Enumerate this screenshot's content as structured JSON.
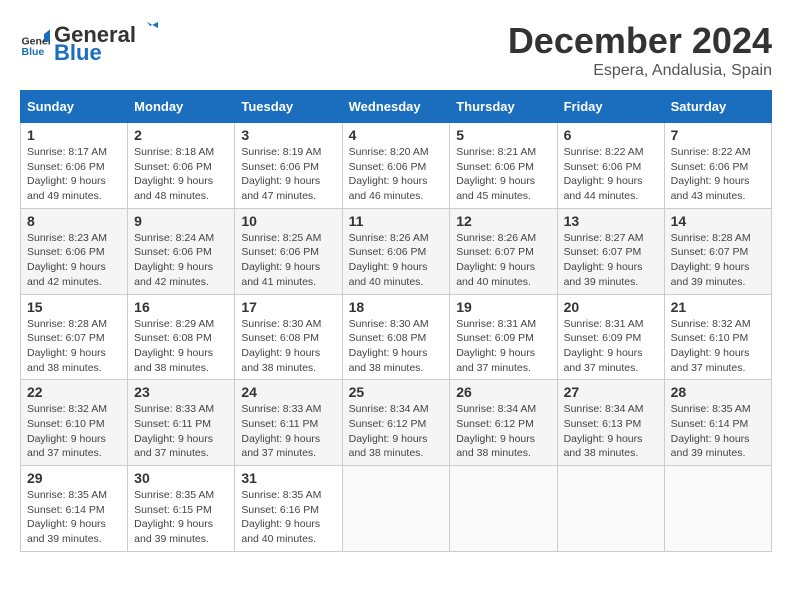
{
  "header": {
    "logo_general": "General",
    "logo_blue": "Blue",
    "main_title": "December 2024",
    "subtitle": "Espera, Andalusia, Spain"
  },
  "calendar": {
    "weekdays": [
      "Sunday",
      "Monday",
      "Tuesday",
      "Wednesday",
      "Thursday",
      "Friday",
      "Saturday"
    ],
    "weeks": [
      [
        {
          "day": "1",
          "sunrise": "8:17 AM",
          "sunset": "6:06 PM",
          "daylight": "9 hours and 49 minutes."
        },
        {
          "day": "2",
          "sunrise": "8:18 AM",
          "sunset": "6:06 PM",
          "daylight": "9 hours and 48 minutes."
        },
        {
          "day": "3",
          "sunrise": "8:19 AM",
          "sunset": "6:06 PM",
          "daylight": "9 hours and 47 minutes."
        },
        {
          "day": "4",
          "sunrise": "8:20 AM",
          "sunset": "6:06 PM",
          "daylight": "9 hours and 46 minutes."
        },
        {
          "day": "5",
          "sunrise": "8:21 AM",
          "sunset": "6:06 PM",
          "daylight": "9 hours and 45 minutes."
        },
        {
          "day": "6",
          "sunrise": "8:22 AM",
          "sunset": "6:06 PM",
          "daylight": "9 hours and 44 minutes."
        },
        {
          "day": "7",
          "sunrise": "8:22 AM",
          "sunset": "6:06 PM",
          "daylight": "9 hours and 43 minutes."
        }
      ],
      [
        {
          "day": "8",
          "sunrise": "8:23 AM",
          "sunset": "6:06 PM",
          "daylight": "9 hours and 42 minutes."
        },
        {
          "day": "9",
          "sunrise": "8:24 AM",
          "sunset": "6:06 PM",
          "daylight": "9 hours and 42 minutes."
        },
        {
          "day": "10",
          "sunrise": "8:25 AM",
          "sunset": "6:06 PM",
          "daylight": "9 hours and 41 minutes."
        },
        {
          "day": "11",
          "sunrise": "8:26 AM",
          "sunset": "6:06 PM",
          "daylight": "9 hours and 40 minutes."
        },
        {
          "day": "12",
          "sunrise": "8:26 AM",
          "sunset": "6:07 PM",
          "daylight": "9 hours and 40 minutes."
        },
        {
          "day": "13",
          "sunrise": "8:27 AM",
          "sunset": "6:07 PM",
          "daylight": "9 hours and 39 minutes."
        },
        {
          "day": "14",
          "sunrise": "8:28 AM",
          "sunset": "6:07 PM",
          "daylight": "9 hours and 39 minutes."
        }
      ],
      [
        {
          "day": "15",
          "sunrise": "8:28 AM",
          "sunset": "6:07 PM",
          "daylight": "9 hours and 38 minutes."
        },
        {
          "day": "16",
          "sunrise": "8:29 AM",
          "sunset": "6:08 PM",
          "daylight": "9 hours and 38 minutes."
        },
        {
          "day": "17",
          "sunrise": "8:30 AM",
          "sunset": "6:08 PM",
          "daylight": "9 hours and 38 minutes."
        },
        {
          "day": "18",
          "sunrise": "8:30 AM",
          "sunset": "6:08 PM",
          "daylight": "9 hours and 38 minutes."
        },
        {
          "day": "19",
          "sunrise": "8:31 AM",
          "sunset": "6:09 PM",
          "daylight": "9 hours and 37 minutes."
        },
        {
          "day": "20",
          "sunrise": "8:31 AM",
          "sunset": "6:09 PM",
          "daylight": "9 hours and 37 minutes."
        },
        {
          "day": "21",
          "sunrise": "8:32 AM",
          "sunset": "6:10 PM",
          "daylight": "9 hours and 37 minutes."
        }
      ],
      [
        {
          "day": "22",
          "sunrise": "8:32 AM",
          "sunset": "6:10 PM",
          "daylight": "9 hours and 37 minutes."
        },
        {
          "day": "23",
          "sunrise": "8:33 AM",
          "sunset": "6:11 PM",
          "daylight": "9 hours and 37 minutes."
        },
        {
          "day": "24",
          "sunrise": "8:33 AM",
          "sunset": "6:11 PM",
          "daylight": "9 hours and 37 minutes."
        },
        {
          "day": "25",
          "sunrise": "8:34 AM",
          "sunset": "6:12 PM",
          "daylight": "9 hours and 38 minutes."
        },
        {
          "day": "26",
          "sunrise": "8:34 AM",
          "sunset": "6:12 PM",
          "daylight": "9 hours and 38 minutes."
        },
        {
          "day": "27",
          "sunrise": "8:34 AM",
          "sunset": "6:13 PM",
          "daylight": "9 hours and 38 minutes."
        },
        {
          "day": "28",
          "sunrise": "8:35 AM",
          "sunset": "6:14 PM",
          "daylight": "9 hours and 39 minutes."
        }
      ],
      [
        {
          "day": "29",
          "sunrise": "8:35 AM",
          "sunset": "6:14 PM",
          "daylight": "9 hours and 39 minutes."
        },
        {
          "day": "30",
          "sunrise": "8:35 AM",
          "sunset": "6:15 PM",
          "daylight": "9 hours and 39 minutes."
        },
        {
          "day": "31",
          "sunrise": "8:35 AM",
          "sunset": "6:16 PM",
          "daylight": "9 hours and 40 minutes."
        },
        null,
        null,
        null,
        null
      ]
    ]
  }
}
